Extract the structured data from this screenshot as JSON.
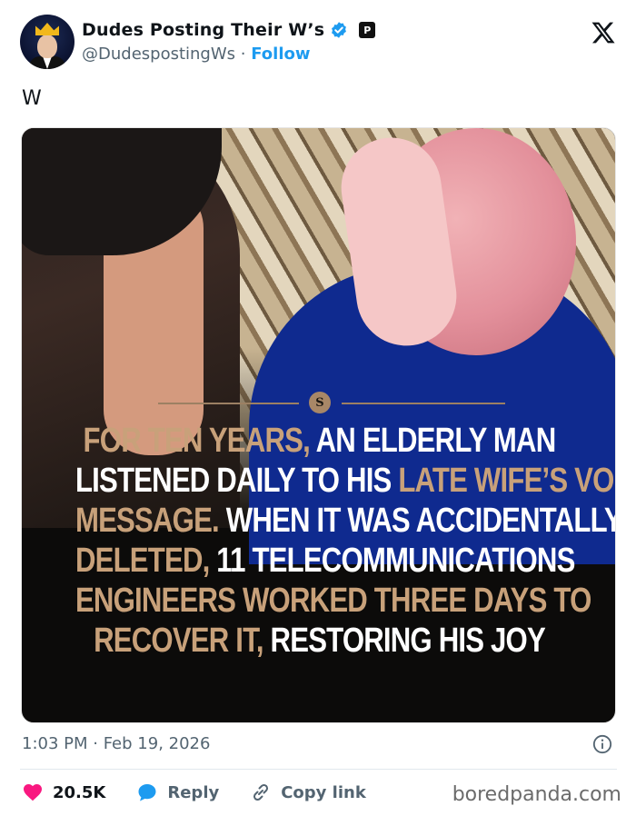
{
  "header": {
    "display_name": "Dudes Posting Their W’s",
    "handle": "@DudespostingWs",
    "separator": "·",
    "follow_label": "Follow",
    "badge_letter": "P",
    "verified_color": "#1d9bf0"
  },
  "tweet": {
    "text": "W"
  },
  "media": {
    "badge_glyph": "S",
    "caption_lines": [
      [
        {
          "t": "FOR TEN YEARS,",
          "gold": true
        },
        {
          "t": " AN ELDERLY MAN",
          "gold": false
        }
      ],
      [
        {
          "t": "LISTENED DAILY TO HIS ",
          "gold": false
        },
        {
          "t": "LATE WIFE’S VOICE",
          "gold": true
        }
      ],
      [
        {
          "t": "MESSAGE.",
          "gold": true
        },
        {
          "t": " WHEN IT WAS ACCIDENTALLY",
          "gold": false
        }
      ],
      [
        {
          "t": "DELETED,",
          "gold": true
        },
        {
          "t": " 11 TELECOMMUNICATIONS",
          "gold": false
        }
      ],
      [
        {
          "t": "ENGINEERS WORKED THREE DAYS TO",
          "gold": true
        }
      ],
      [
        {
          "t": "RECOVER IT,",
          "gold": true
        },
        {
          "t": " RESTORING HIS JOY",
          "gold": false
        }
      ]
    ],
    "colors": {
      "gold": "#c8a17a",
      "white": "#ffffff"
    }
  },
  "meta": {
    "timestamp": "1:03 PM · Feb 19, 2026"
  },
  "actions": {
    "likes_count": "20.5K",
    "reply_label": "Reply",
    "copy_link_label": "Copy link",
    "like_color": "#f91880",
    "reply_color": "#1d9bf0"
  },
  "watermark": "boredpanda.com",
  "icons": [
    "x-logo-icon",
    "verified-icon",
    "heart-icon",
    "reply-bubble-icon",
    "link-icon",
    "info-icon"
  ]
}
